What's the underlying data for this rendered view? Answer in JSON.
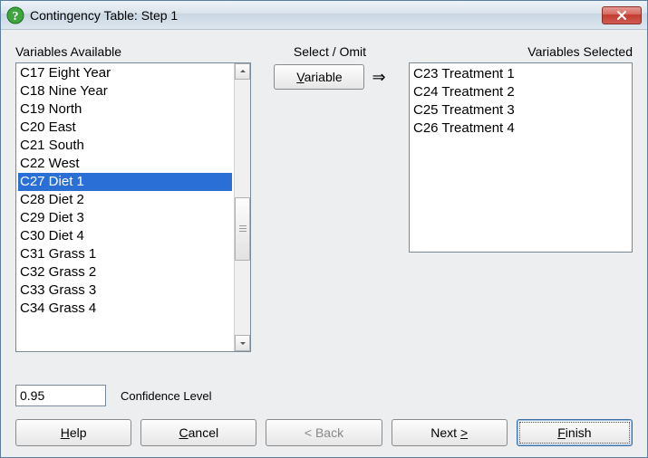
{
  "window": {
    "title": "Contingency Table: Step 1"
  },
  "labels": {
    "available": "Variables Available",
    "select_omit": "Select / Omit",
    "selected": "Variables Selected",
    "confidence": "Confidence Level"
  },
  "buttons": {
    "variable": "Variable",
    "help": "Help",
    "cancel": "Cancel",
    "back": "< Back",
    "next": "Next >",
    "finish": "Finish"
  },
  "confidence_value": "0.95",
  "available_items": [
    "C17 Eight Year",
    "C18 Nine Year",
    "C19 North",
    "C20 East",
    "C21 South",
    "C22 West",
    "C27 Diet 1",
    "C28 Diet 2",
    "C29 Diet 3",
    "C30 Diet 4",
    "C31 Grass 1",
    "C32 Grass 2",
    "C33 Grass 3",
    "C34 Grass 4"
  ],
  "available_selected_index": 6,
  "selected_items": [
    "C23 Treatment 1",
    "C24 Treatment 2",
    "C25 Treatment 3",
    "C26 Treatment 4"
  ]
}
